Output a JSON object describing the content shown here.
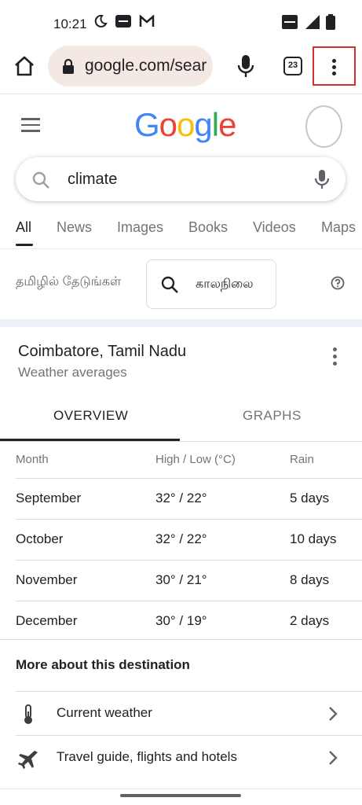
{
  "status_bar": {
    "time": "10:21",
    "icons": [
      "moon-icon",
      "paytm-icon",
      "gmail-icon"
    ],
    "right_icons": [
      "volte-icon",
      "4g-signal-icon",
      "battery-icon"
    ]
  },
  "toolbar": {
    "url": "google.com/sear",
    "tab_count": "23"
  },
  "logo": {
    "letters": [
      {
        "char": "G",
        "color": "#4285F4"
      },
      {
        "char": "o",
        "color": "#EA4335"
      },
      {
        "char": "o",
        "color": "#FBBC05"
      },
      {
        "char": "g",
        "color": "#4285F4"
      },
      {
        "char": "l",
        "color": "#34A853"
      },
      {
        "char": "e",
        "color": "#EA4335"
      }
    ]
  },
  "search": {
    "query": "climate"
  },
  "nav_tabs": [
    "All",
    "News",
    "Images",
    "Books",
    "Videos",
    "Maps"
  ],
  "tamil": {
    "label": "தமிழில் தேடுங்கள்",
    "chip": "காலநிலை"
  },
  "weather": {
    "title": "Coimbatore, Tamil Nadu",
    "subtitle": "Weather averages",
    "tabs": [
      "OVERVIEW",
      "GRAPHS"
    ],
    "columns": [
      "Month",
      "High / Low  (°C)",
      "Rain"
    ],
    "rows": [
      [
        "September",
        "32° / 22°",
        "5 days"
      ],
      [
        "October",
        "32° / 22°",
        "10 days"
      ],
      [
        "November",
        "30° / 21°",
        "8 days"
      ],
      [
        "December",
        "30° / 19°",
        "2 days"
      ]
    ]
  },
  "more": {
    "title": "More about this destination",
    "items": [
      {
        "label": "Current weather",
        "icon": "thermometer-icon"
      },
      {
        "label": "Travel guide, flights and hotels",
        "icon": "airplane-icon"
      }
    ]
  },
  "colors": {
    "urlbar_bg": "#f4e8e3",
    "highlight_box": "#d32f2f"
  }
}
